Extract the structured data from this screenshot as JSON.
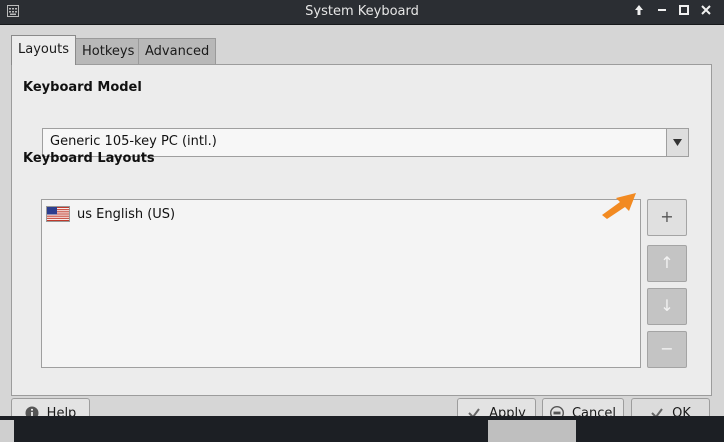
{
  "window": {
    "title": "System Keyboard"
  },
  "tabs": [
    {
      "label": "Layouts",
      "active": true
    },
    {
      "label": "Hotkeys",
      "active": false
    },
    {
      "label": "Advanced",
      "active": false
    }
  ],
  "keyboard_model": {
    "label": "Keyboard Model",
    "selected": "Generic 105-key PC (intl.)"
  },
  "keyboard_layouts": {
    "label": "Keyboard Layouts",
    "items": [
      {
        "flag_icon": "us-flag-icon",
        "text": "us English (US)"
      }
    ]
  },
  "side_buttons": [
    {
      "name": "add",
      "glyph": "+",
      "enabled": true
    },
    {
      "name": "move-up",
      "glyph": "↑",
      "enabled": false
    },
    {
      "name": "move-down",
      "glyph": "↓",
      "enabled": false
    },
    {
      "name": "remove",
      "glyph": "−",
      "enabled": false
    }
  ],
  "buttons": {
    "help": "Help",
    "apply": "Apply",
    "cancel": "Cancel",
    "ok": "OK"
  },
  "colors": {
    "accent_arrow": "#f28a21",
    "titlebar": "#2b2e33"
  }
}
